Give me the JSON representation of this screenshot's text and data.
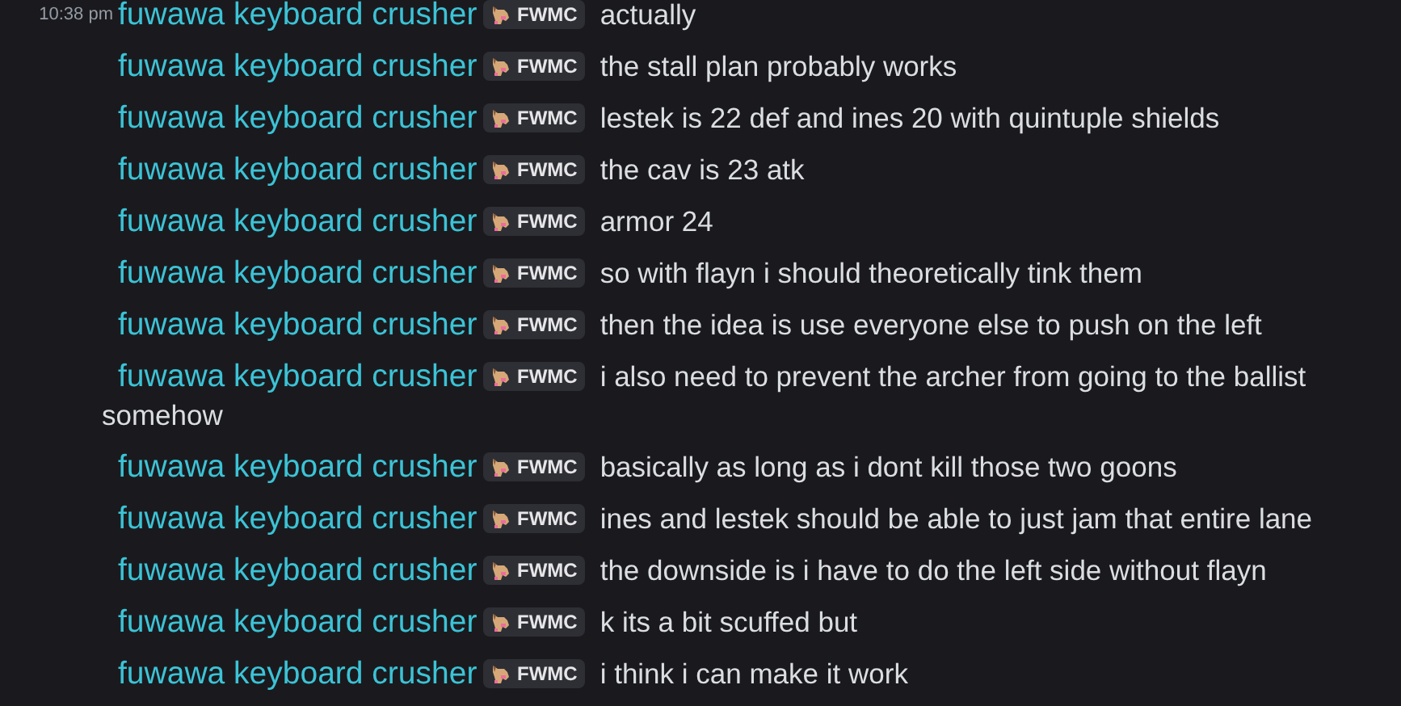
{
  "messages": [
    {
      "time": "10:38 pm",
      "author": "fuwawa keyboard crusher",
      "tag": "FWMC",
      "text": "actually"
    },
    {
      "author": "fuwawa keyboard crusher",
      "tag": "FWMC",
      "text": "the stall plan probably works"
    },
    {
      "author": "fuwawa keyboard crusher",
      "tag": "FWMC",
      "text": "lestek is 22 def and ines 20 with quintuple shields"
    },
    {
      "author": "fuwawa keyboard crusher",
      "tag": "FWMC",
      "text": "the cav is 23 atk"
    },
    {
      "author": "fuwawa keyboard crusher",
      "tag": "FWMC",
      "text": "armor 24"
    },
    {
      "author": "fuwawa keyboard crusher",
      "tag": "FWMC",
      "text": "so with flayn i should theoretically tink them"
    },
    {
      "author": "fuwawa keyboard crusher",
      "tag": "FWMC",
      "text": "then the idea is use everyone else to push on the left"
    },
    {
      "author": "fuwawa keyboard crusher",
      "tag": "FWMC",
      "text": "i also need to prevent the archer from going to the ballist",
      "continuation": "somehow"
    },
    {
      "author": "fuwawa keyboard crusher",
      "tag": "FWMC",
      "text": "basically as long as i dont kill those two goons"
    },
    {
      "author": "fuwawa keyboard crusher",
      "tag": "FWMC",
      "text": "ines and lestek should be able to just jam that entire lane"
    },
    {
      "author": "fuwawa keyboard crusher",
      "tag": "FWMC",
      "text": "the downside is i have to do the left side without flayn"
    },
    {
      "author": "fuwawa keyboard crusher",
      "tag": "FWMC",
      "text": "k its a bit scuffed but"
    },
    {
      "author": "fuwawa keyboard crusher",
      "tag": "FWMC",
      "text": "i think i can make it work"
    }
  ]
}
